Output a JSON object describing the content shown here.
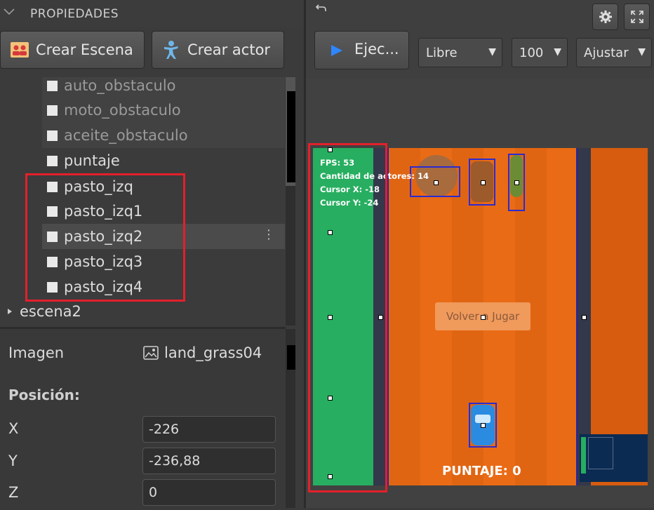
{
  "panel": {
    "header_title": "PROPIEDADES",
    "buttons": {
      "create_scene": "Crear Escena",
      "create_actor": "Crear actor"
    }
  },
  "tree": {
    "items": [
      {
        "label": "auto_obstaculo",
        "state": "dim"
      },
      {
        "label": "moto_obstaculo",
        "state": "dim"
      },
      {
        "label": "aceite_obstaculo",
        "state": "dim"
      },
      {
        "label": "puntaje",
        "state": "normal"
      },
      {
        "label": "pasto_izq",
        "state": "normal"
      },
      {
        "label": "pasto_izq1",
        "state": "normal"
      },
      {
        "label": "pasto_izq2",
        "state": "selected"
      },
      {
        "label": "pasto_izq3",
        "state": "normal"
      },
      {
        "label": "pasto_izq4",
        "state": "normal"
      }
    ],
    "scene2": "escena2",
    "more_icon": "⋮"
  },
  "properties": {
    "image_label": "Imagen",
    "image_value": "land_grass04",
    "position_header": "Posición:",
    "x_label": "X",
    "x_value": "-226",
    "y_label": "Y",
    "y_value": "-236,88",
    "z_label": "Z",
    "z_value": "0"
  },
  "editor": {
    "run_label": "Ejec...",
    "mode_select": "Libre",
    "zoom_select": "100",
    "fit_select": "Ajustar"
  },
  "hud": {
    "fps": "FPS: 53",
    "actors": "Cantidad de actores: 14",
    "cursor_x": "Cursor X: -18",
    "cursor_y": "Cursor Y: -24"
  },
  "game": {
    "replay_button": "Volver a Jugar",
    "score": "PUNTAJE: 0"
  },
  "colors": {
    "highlight": "#e3202b",
    "grass": "#27ae60",
    "road": "#e96b16",
    "accent": "#2f86ff"
  }
}
